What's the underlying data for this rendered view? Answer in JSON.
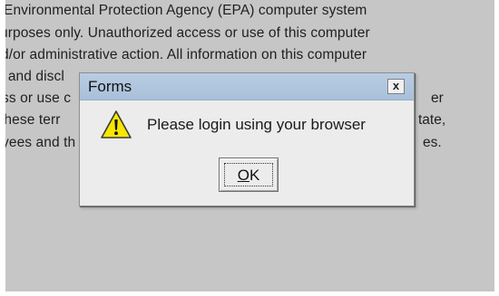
{
  "background": {
    "lines": [
      "Environmental Protection Agency (EPA) computer system",
      "urposes only. Unauthorized access or use of this computer",
      "d/or administrative action. All information on this computer",
      ", and discl",
      "ss or use c",
      "these terr",
      "yees and th"
    ],
    "right_fragments": [
      "er",
      "tate,",
      "es."
    ]
  },
  "dialog": {
    "title": "Forms",
    "close_label": "x",
    "icon": "warning-icon",
    "message": "Please login using your browser",
    "ok_mnemonic": "O",
    "ok_rest": "K"
  },
  "colors": {
    "background": "#c6c6c6",
    "titlebar": "#abc2dc",
    "dialog": "#ececec",
    "warning_fill": "#f6e700"
  }
}
